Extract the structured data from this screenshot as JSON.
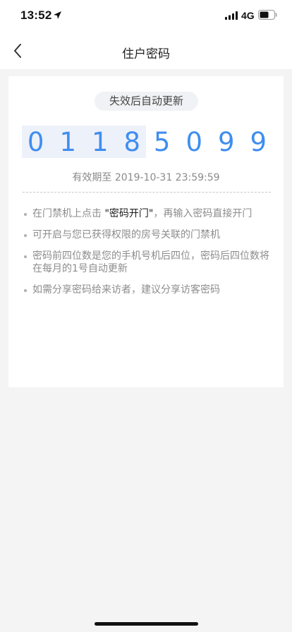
{
  "status_bar": {
    "time": "13:52",
    "network": "4G",
    "icons": [
      "location-arrow-icon",
      "signal-bars-icon",
      "battery-icon"
    ]
  },
  "nav": {
    "back_icon": "chevron-left-icon",
    "title": "住户密码"
  },
  "card": {
    "status_pill": "失效后自动更新",
    "code_part_1": "0118",
    "code_part_2": "5099",
    "expiry": "有效期至 2019-10-31 23:59:59",
    "notes": [
      {
        "prefix": "在门禁机上点击 ",
        "highlight": "\"密码开门\"",
        "suffix": "，再输入密码直接开门"
      },
      {
        "text": "可开启与您已获得权限的房号关联的门禁机"
      },
      {
        "text": "密码前四位数是您的手机号机后四位，密码后四位数将在每月的1号自动更新"
      },
      {
        "text": "如需分享密码给来访者，建议分享访客密码"
      }
    ]
  },
  "colors": {
    "accent_blue": "#3f8ef0",
    "code_bg": "#edf1f9",
    "page_bg": "#f4f4f5",
    "muted_text": "#8c8c8c"
  }
}
